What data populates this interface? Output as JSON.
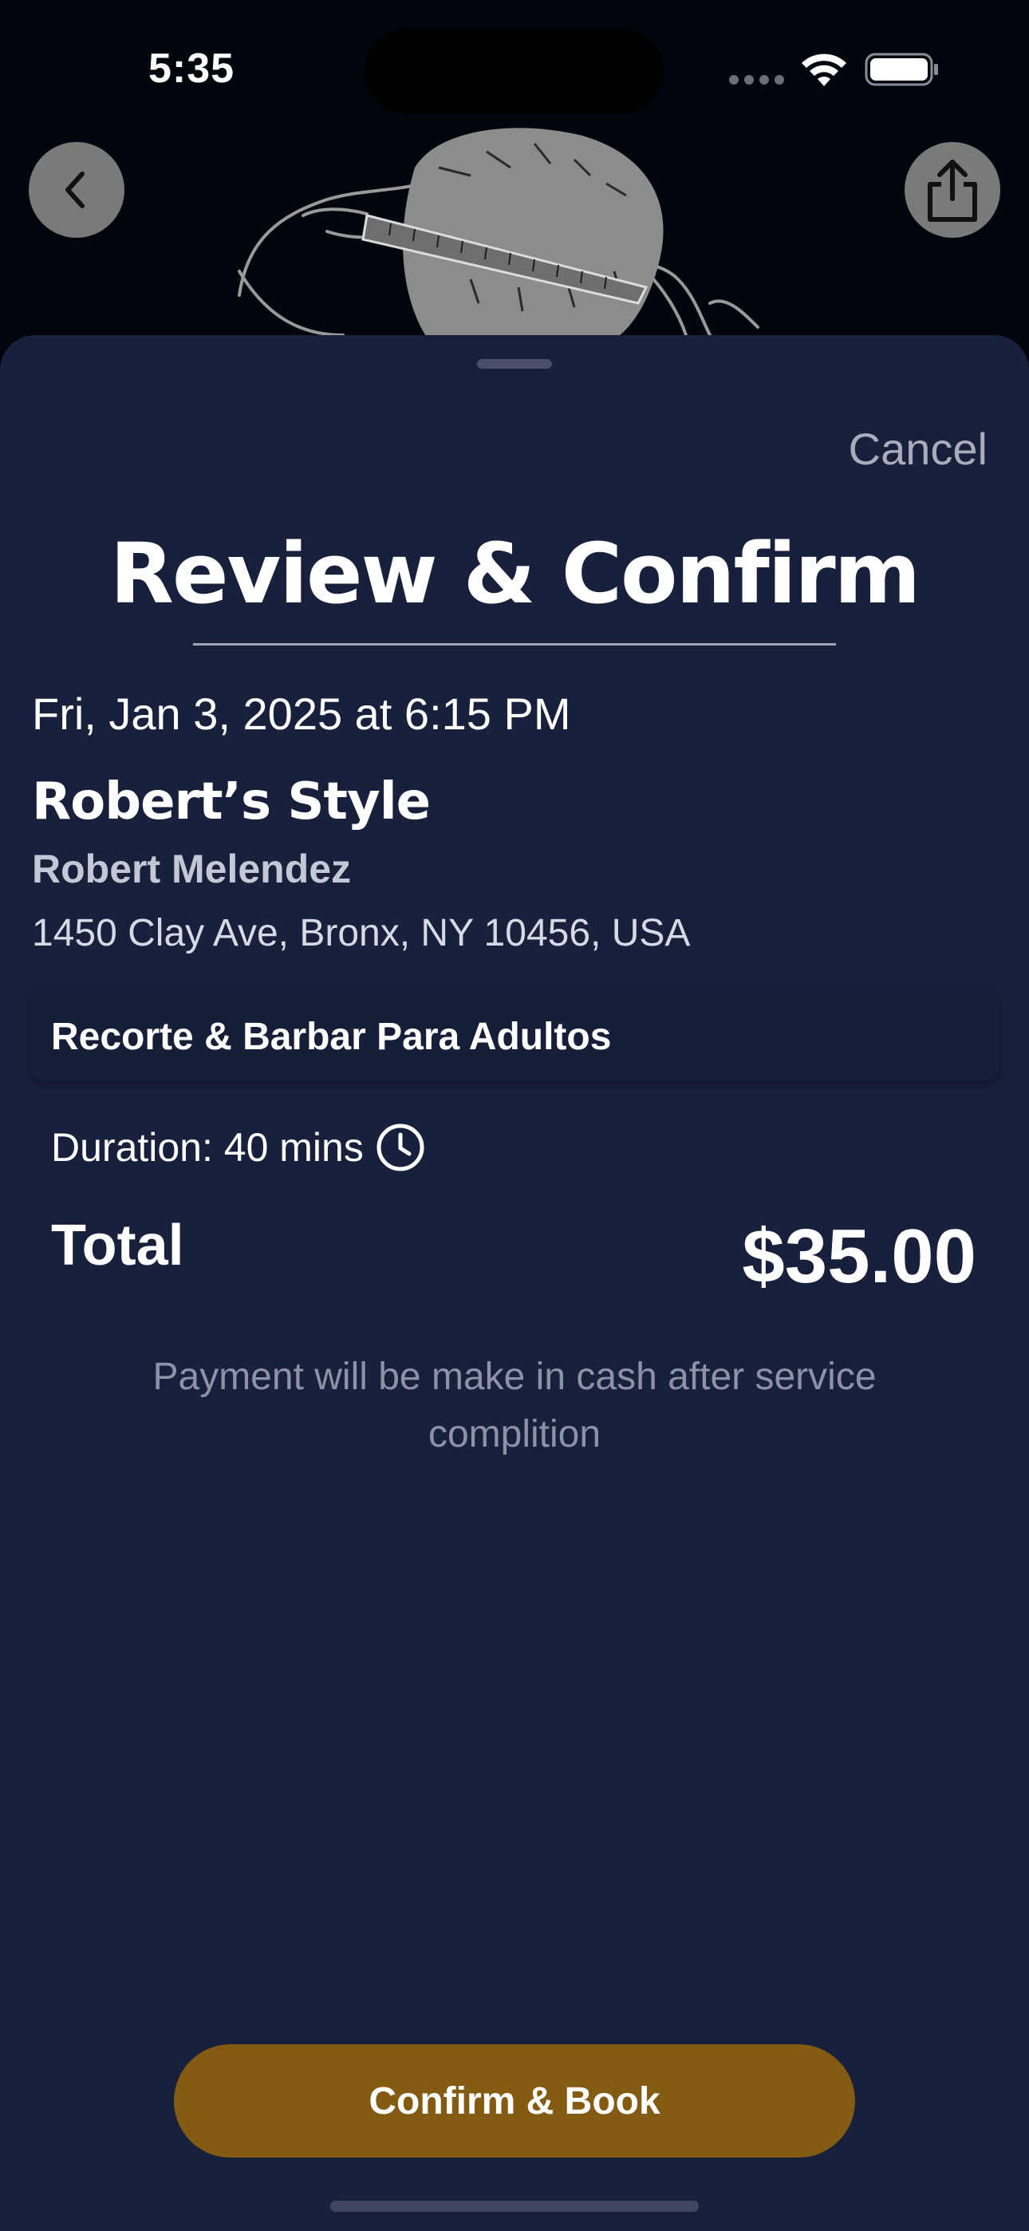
{
  "status_bar": {
    "time": "5:35"
  },
  "header": {
    "back_icon": "chevron-left-icon",
    "share_icon": "share-icon",
    "hero_image": "barber-haircut-illustration"
  },
  "sheet": {
    "cancel_label": "Cancel",
    "title": "Review & Confirm",
    "appointment_datetime": "Fri, Jan 3, 2025 at 6:15 PM",
    "shop_name": "Robert’s Style",
    "barber_name": "Robert Melendez",
    "address": "1450 Clay Ave, Bronx, NY 10456, USA",
    "service_name": "Recorte & Barbar Para Adultos",
    "duration": "Duration: 40 mins",
    "total_label": "Total",
    "total_amount": "$35.00",
    "payment_note": "Payment will be make in cash after service complition",
    "confirm_label": "Confirm & Book"
  },
  "colors": {
    "sheet_background": "#18203c",
    "confirm_button": "#845b12",
    "icon_button": "#7a7a7a"
  }
}
